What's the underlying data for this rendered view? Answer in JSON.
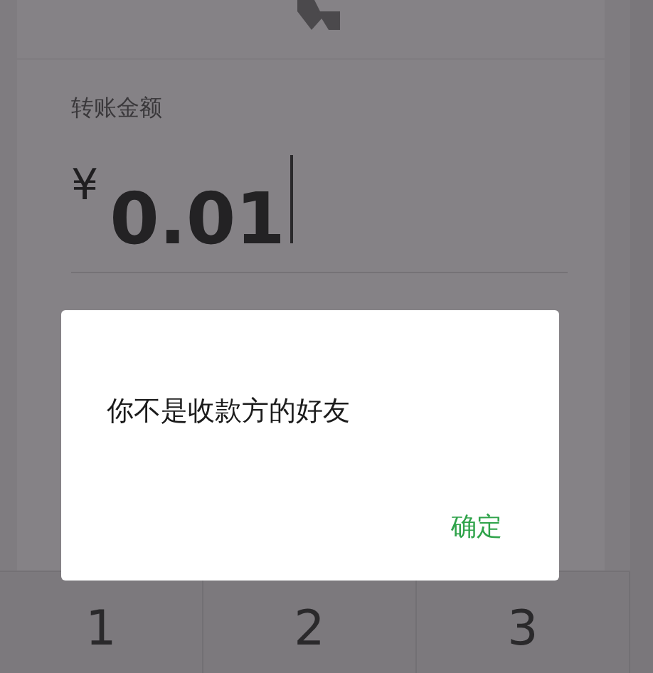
{
  "transfer": {
    "amount_label": "转账金额",
    "currency": "¥",
    "amount": "0.01"
  },
  "dialog": {
    "message": "你不是收款方的好友",
    "button": "确定"
  },
  "keypad": {
    "keys": [
      "1",
      "2",
      "3"
    ]
  }
}
